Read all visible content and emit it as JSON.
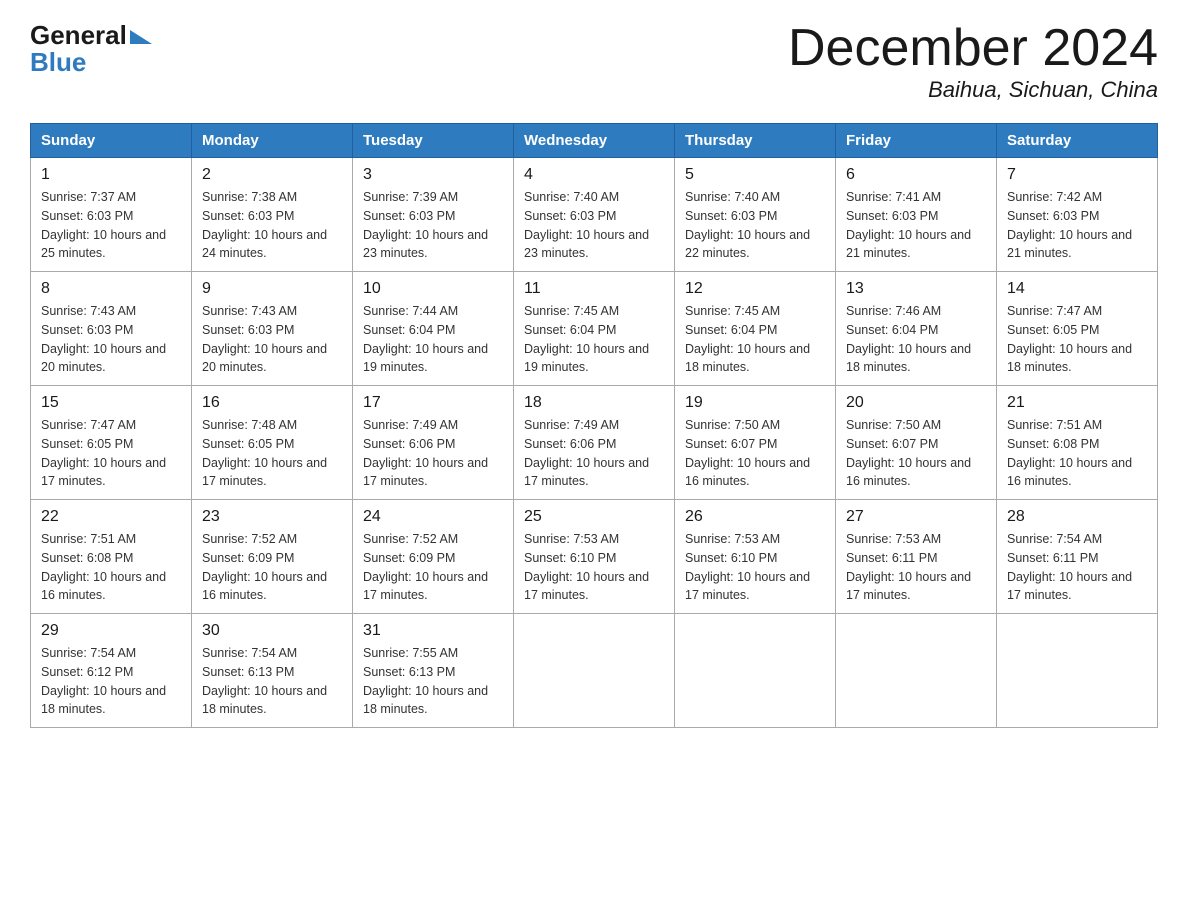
{
  "logo": {
    "general": "General",
    "blue": "Blue"
  },
  "title": "December 2024",
  "location": "Baihua, Sichuan, China",
  "days_of_week": [
    "Sunday",
    "Monday",
    "Tuesday",
    "Wednesday",
    "Thursday",
    "Friday",
    "Saturday"
  ],
  "weeks": [
    [
      {
        "day": "1",
        "sunrise": "7:37 AM",
        "sunset": "6:03 PM",
        "daylight": "10 hours and 25 minutes."
      },
      {
        "day": "2",
        "sunrise": "7:38 AM",
        "sunset": "6:03 PM",
        "daylight": "10 hours and 24 minutes."
      },
      {
        "day": "3",
        "sunrise": "7:39 AM",
        "sunset": "6:03 PM",
        "daylight": "10 hours and 23 minutes."
      },
      {
        "day": "4",
        "sunrise": "7:40 AM",
        "sunset": "6:03 PM",
        "daylight": "10 hours and 23 minutes."
      },
      {
        "day": "5",
        "sunrise": "7:40 AM",
        "sunset": "6:03 PM",
        "daylight": "10 hours and 22 minutes."
      },
      {
        "day": "6",
        "sunrise": "7:41 AM",
        "sunset": "6:03 PM",
        "daylight": "10 hours and 21 minutes."
      },
      {
        "day": "7",
        "sunrise": "7:42 AM",
        "sunset": "6:03 PM",
        "daylight": "10 hours and 21 minutes."
      }
    ],
    [
      {
        "day": "8",
        "sunrise": "7:43 AM",
        "sunset": "6:03 PM",
        "daylight": "10 hours and 20 minutes."
      },
      {
        "day": "9",
        "sunrise": "7:43 AM",
        "sunset": "6:03 PM",
        "daylight": "10 hours and 20 minutes."
      },
      {
        "day": "10",
        "sunrise": "7:44 AM",
        "sunset": "6:04 PM",
        "daylight": "10 hours and 19 minutes."
      },
      {
        "day": "11",
        "sunrise": "7:45 AM",
        "sunset": "6:04 PM",
        "daylight": "10 hours and 19 minutes."
      },
      {
        "day": "12",
        "sunrise": "7:45 AM",
        "sunset": "6:04 PM",
        "daylight": "10 hours and 18 minutes."
      },
      {
        "day": "13",
        "sunrise": "7:46 AM",
        "sunset": "6:04 PM",
        "daylight": "10 hours and 18 minutes."
      },
      {
        "day": "14",
        "sunrise": "7:47 AM",
        "sunset": "6:05 PM",
        "daylight": "10 hours and 18 minutes."
      }
    ],
    [
      {
        "day": "15",
        "sunrise": "7:47 AM",
        "sunset": "6:05 PM",
        "daylight": "10 hours and 17 minutes."
      },
      {
        "day": "16",
        "sunrise": "7:48 AM",
        "sunset": "6:05 PM",
        "daylight": "10 hours and 17 minutes."
      },
      {
        "day": "17",
        "sunrise": "7:49 AM",
        "sunset": "6:06 PM",
        "daylight": "10 hours and 17 minutes."
      },
      {
        "day": "18",
        "sunrise": "7:49 AM",
        "sunset": "6:06 PM",
        "daylight": "10 hours and 17 minutes."
      },
      {
        "day": "19",
        "sunrise": "7:50 AM",
        "sunset": "6:07 PM",
        "daylight": "10 hours and 16 minutes."
      },
      {
        "day": "20",
        "sunrise": "7:50 AM",
        "sunset": "6:07 PM",
        "daylight": "10 hours and 16 minutes."
      },
      {
        "day": "21",
        "sunrise": "7:51 AM",
        "sunset": "6:08 PM",
        "daylight": "10 hours and 16 minutes."
      }
    ],
    [
      {
        "day": "22",
        "sunrise": "7:51 AM",
        "sunset": "6:08 PM",
        "daylight": "10 hours and 16 minutes."
      },
      {
        "day": "23",
        "sunrise": "7:52 AM",
        "sunset": "6:09 PM",
        "daylight": "10 hours and 16 minutes."
      },
      {
        "day": "24",
        "sunrise": "7:52 AM",
        "sunset": "6:09 PM",
        "daylight": "10 hours and 17 minutes."
      },
      {
        "day": "25",
        "sunrise": "7:53 AM",
        "sunset": "6:10 PM",
        "daylight": "10 hours and 17 minutes."
      },
      {
        "day": "26",
        "sunrise": "7:53 AM",
        "sunset": "6:10 PM",
        "daylight": "10 hours and 17 minutes."
      },
      {
        "day": "27",
        "sunrise": "7:53 AM",
        "sunset": "6:11 PM",
        "daylight": "10 hours and 17 minutes."
      },
      {
        "day": "28",
        "sunrise": "7:54 AM",
        "sunset": "6:11 PM",
        "daylight": "10 hours and 17 minutes."
      }
    ],
    [
      {
        "day": "29",
        "sunrise": "7:54 AM",
        "sunset": "6:12 PM",
        "daylight": "10 hours and 18 minutes."
      },
      {
        "day": "30",
        "sunrise": "7:54 AM",
        "sunset": "6:13 PM",
        "daylight": "10 hours and 18 minutes."
      },
      {
        "day": "31",
        "sunrise": "7:55 AM",
        "sunset": "6:13 PM",
        "daylight": "10 hours and 18 minutes."
      },
      null,
      null,
      null,
      null
    ]
  ]
}
